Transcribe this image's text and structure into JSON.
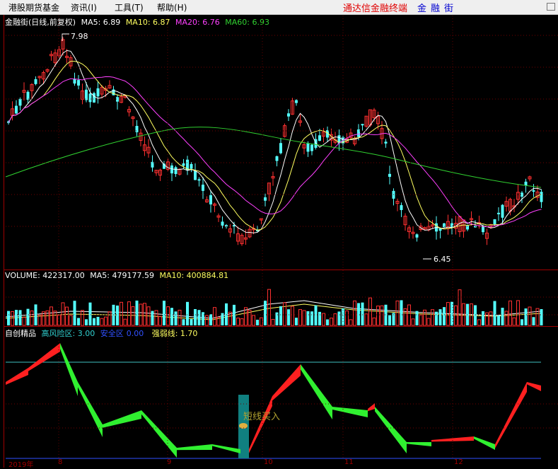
{
  "menu": {
    "items": [
      "港股期货基金",
      "资讯(I)",
      "工具(T)",
      "帮助(H)"
    ],
    "brand": "通达信金融终端",
    "stock_name": "金融街"
  },
  "price_panel": {
    "title": "金融街(日线,前复权)",
    "ma5": "MA5: 6.89",
    "ma10": "MA10: 6.87",
    "ma20": "MA20: 6.76",
    "ma60": "MA60: 6.93",
    "high_label": "7.98",
    "low_label": "6.45",
    "colors": {
      "up": "#ff3030",
      "down": "#54ffff",
      "ma5": "#ffffff",
      "ma10": "#ffff60",
      "ma20": "#ff40ff",
      "ma60": "#30d030"
    }
  },
  "volume_panel": {
    "volume": "VOLUME: 422317.00",
    "ma5": "MA5: 479177.59",
    "ma10": "MA10: 400884.81"
  },
  "indicator_panel": {
    "title": "自创精品",
    "high_risk": "高风险区: 3.00",
    "safe_zone_label": "安全区",
    "safe_zone_value": "0.00",
    "strength": "强弱线: 1.70",
    "signal_text": "短线买入"
  },
  "axis": {
    "dates": [
      "2019年",
      "8",
      "9",
      "10",
      "11",
      "12"
    ]
  }
}
